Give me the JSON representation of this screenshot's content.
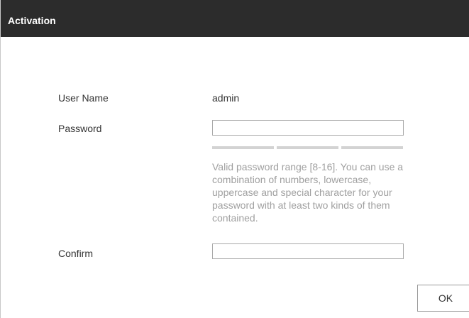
{
  "dialog": {
    "title": "Activation",
    "username_label": "User Name",
    "username_value": "admin",
    "password_label": "Password",
    "password_value": "",
    "strength_segments": 3,
    "hint": "Valid password range [8-16]. You can use a combination of numbers, lowercase, uppercase and special character for your password with at least two kinds of them contained.",
    "confirm_label": "Confirm",
    "confirm_value": "",
    "ok_label": "OK"
  },
  "colors": {
    "titlebar": "#2c2c2c",
    "strength_empty": "#d3d3d3",
    "hint_text": "#a0a0a0"
  }
}
